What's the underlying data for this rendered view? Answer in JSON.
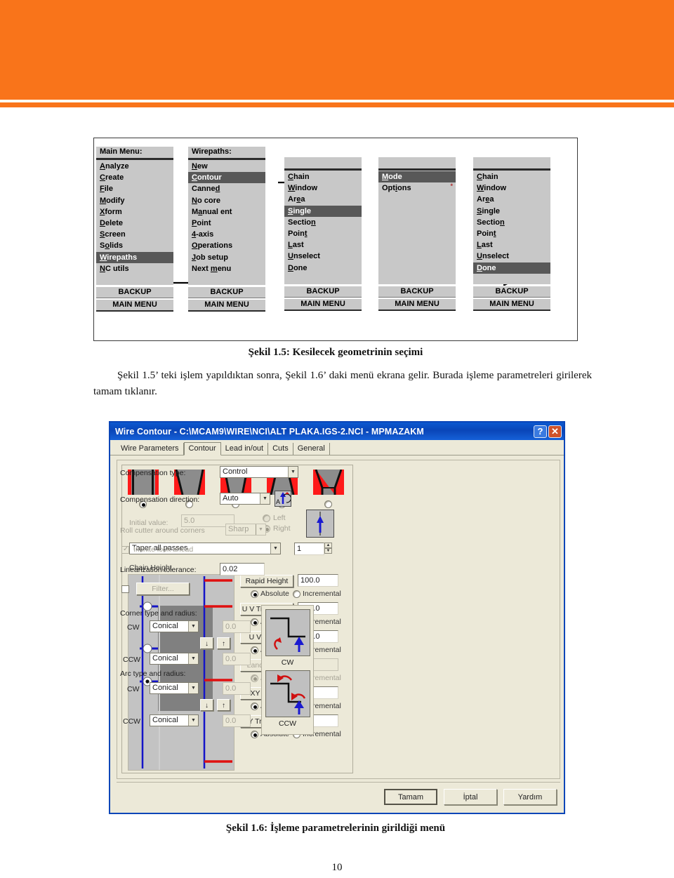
{
  "theme": {
    "accent_orange": "#f9741a",
    "title_blue": "#0a46b8",
    "menu_gray": "#c8c8c8",
    "menu_selected": "#585858"
  },
  "figure15": {
    "columns": [
      {
        "title": "Main Menu:",
        "items": [
          {
            "pre": "",
            "key": "A",
            "post": "nalyze"
          },
          {
            "pre": "",
            "key": "C",
            "post": "reate"
          },
          {
            "pre": "",
            "key": "F",
            "post": "ile"
          },
          {
            "pre": "",
            "key": "M",
            "post": "odify"
          },
          {
            "pre": "",
            "key": "X",
            "post": "form"
          },
          {
            "pre": "",
            "key": "D",
            "post": "elete"
          },
          {
            "pre": "",
            "key": "S",
            "post": "creen"
          },
          {
            "pre": "S",
            "key": "o",
            "post": "lids"
          },
          {
            "pre": "",
            "key": "W",
            "post": "irepaths",
            "selected": true
          },
          {
            "pre": "",
            "key": "N",
            "post": "C utils"
          }
        ],
        "backup": "BACKUP",
        "mainmenu": "MAIN MENU"
      },
      {
        "title": "Wirepaths:",
        "items": [
          {
            "pre": "",
            "key": "N",
            "post": "ew"
          },
          {
            "pre": "",
            "key": "C",
            "post": "ontour",
            "selected": true
          },
          {
            "pre": "Canne",
            "key": "d",
            "post": ""
          },
          {
            "pre": "",
            "key": "N",
            "post": "o core"
          },
          {
            "pre": "M",
            "key": "a",
            "post": "nual ent"
          },
          {
            "pre": "",
            "key": "P",
            "post": "oint"
          },
          {
            "pre": "",
            "key": "4",
            "post": "-axis"
          },
          {
            "pre": "",
            "key": "O",
            "post": "perations"
          },
          {
            "pre": "",
            "key": "J",
            "post": "ob setup"
          },
          {
            "pre": "Next ",
            "key": "m",
            "post": "enu"
          }
        ],
        "backup": "BACKUP",
        "mainmenu": "MAIN MENU"
      },
      {
        "title": "",
        "items": [
          {
            "pre": "",
            "key": "C",
            "post": "hain"
          },
          {
            "pre": "",
            "key": "W",
            "post": "indow"
          },
          {
            "pre": "Ar",
            "key": "e",
            "post": "a"
          },
          {
            "pre": "",
            "key": "S",
            "post": "ingle",
            "selected": true
          },
          {
            "pre": "Sectio",
            "key": "n",
            "post": ""
          },
          {
            "pre": "Poin",
            "key": "t",
            "post": ""
          },
          {
            "pre": "",
            "key": "L",
            "post": "ast"
          },
          {
            "pre": "",
            "key": "U",
            "post": "nselect"
          },
          {
            "pre": "",
            "key": "D",
            "post": "one"
          }
        ],
        "backup": "BACKUP",
        "mainmenu": "MAIN MENU"
      },
      {
        "title": "",
        "items": [
          {
            "pre": "",
            "key": "M",
            "post": "ode",
            "selected": true
          },
          {
            "pre": "Opt",
            "key": "i",
            "post": "ons",
            "star": true
          }
        ],
        "backup": "BACKUP",
        "mainmenu": "MAIN MENU"
      },
      {
        "title": "",
        "items": [
          {
            "pre": "",
            "key": "C",
            "post": "hain"
          },
          {
            "pre": "",
            "key": "W",
            "post": "indow"
          },
          {
            "pre": "Ar",
            "key": "e",
            "post": "a"
          },
          {
            "pre": "",
            "key": "S",
            "post": "ingle"
          },
          {
            "pre": "Sectio",
            "key": "n",
            "post": ""
          },
          {
            "pre": "Poin",
            "key": "t",
            "post": ""
          },
          {
            "pre": "",
            "key": "L",
            "post": "ast"
          },
          {
            "pre": "",
            "key": "U",
            "post": "nselect"
          },
          {
            "pre": "",
            "key": "D",
            "post": "one",
            "selected": true
          }
        ],
        "backup": "BACKUP",
        "mainmenu": "MAIN MENU"
      }
    ]
  },
  "caption15": "Şekil 1.5: Kesilecek geometrinin seçimi",
  "paragraph1_a": "Şekil 1.5’ teki işlem yapıldıktan sonra, Şekil 1.6’ daki menü ekrana gelir. Burada",
  "paragraph1_b": "işleme parametreleri girilerek tamam tıklanır.",
  "caption16": "Şekil 1.6: İşleme parametrelerinin girildiği menü",
  "page_number": "10",
  "dialog": {
    "title": "Wire Contour  - C:\\MCAM9\\WIRE\\NCI\\ALT PLAKA.IGS-2.NCI - MPMAZAKM",
    "help_button": "?",
    "close_button": "✕",
    "tabs": [
      {
        "label": "Wire Parameters",
        "active": false
      },
      {
        "label": "Contour",
        "active": true
      },
      {
        "label": "Lead in/out",
        "active": false
      },
      {
        "label": "Cuts",
        "active": false
      },
      {
        "label": "General",
        "active": false
      }
    ],
    "left": {
      "taper_options": [
        "no-taper",
        "taper-right",
        "taper-in",
        "taper-step",
        "taper-trapezoid"
      ],
      "selected_taper": 0,
      "initial_value_label": "Initial value:",
      "initial_value": "5.0",
      "side_left_label": "Left",
      "side_right_label": "Right",
      "side_selected": "Right",
      "taper_mode": "Taper all passes",
      "pass_count": "1",
      "chain_height_label": "Chain Height",
      "height_rows": [
        {
          "button": "Rapid Height",
          "value": "100.0",
          "mode": "Absolute",
          "abs": "Absolute",
          "inc": "Incremental",
          "disabled": false
        },
        {
          "button": "U V Trim Plane",
          "value": "100.0",
          "mode": "Absolute",
          "abs": "Absolute",
          "inc": "Incremental",
          "disabled": false
        },
        {
          "button": "U V Height",
          "value": "100.0",
          "mode": "Absolute",
          "abs": "Absolute",
          "inc": "Incremental",
          "disabled": false
        },
        {
          "button": "Land Height",
          "value": "5.0",
          "mode": "Absolute",
          "abs": "Absolute",
          "inc": "Incremental",
          "disabled": true
        },
        {
          "button": "XY Height",
          "value": "0.0",
          "mode": "Absolute",
          "abs": "Absolute",
          "inc": "Incremental",
          "disabled": false
        },
        {
          "button": "XY Trim Plane",
          "value": "0.0",
          "mode": "Absolute",
          "abs": "Absolute",
          "inc": "Incremental",
          "disabled": false
        }
      ]
    },
    "right": {
      "compensation_type_label": "Compensation type:",
      "compensation_type_value": "Control",
      "compensation_direction_label": "Compensation direction:",
      "compensation_direction_value": "Auto",
      "roll_cutter_label": "Roll cutter around corners",
      "roll_cutter_value": "Sharp",
      "infinite_look_ahead_label": "Infinite look ahead",
      "infinite_look_ahead_checked": true,
      "linearization_label": "Linearization tolerance:",
      "linearization_value": "0.02",
      "filter_checked": false,
      "filter_button": "Filter...",
      "corner_group_label": "Corner type and radius:",
      "corner_cw_label": "CW",
      "corner_cw_type": "Conical",
      "corner_cw_radius": "0.0",
      "corner_ccw_label": "CCW",
      "corner_ccw_type": "Conical",
      "corner_ccw_radius": "0.0",
      "arc_group_label": "Arc type and radius:",
      "arc_cw_label": "CW",
      "arc_cw_type": "Conical",
      "arc_cw_radius": "0.0",
      "arc_ccw_label": "CCW",
      "arc_ccw_type": "Conical",
      "arc_ccw_radius": "0.0",
      "preview_cw_caption": "CW",
      "preview_ccw_caption": "CCW"
    },
    "buttons": {
      "ok": "Tamam",
      "cancel": "İptal",
      "help": "Yardım"
    }
  }
}
